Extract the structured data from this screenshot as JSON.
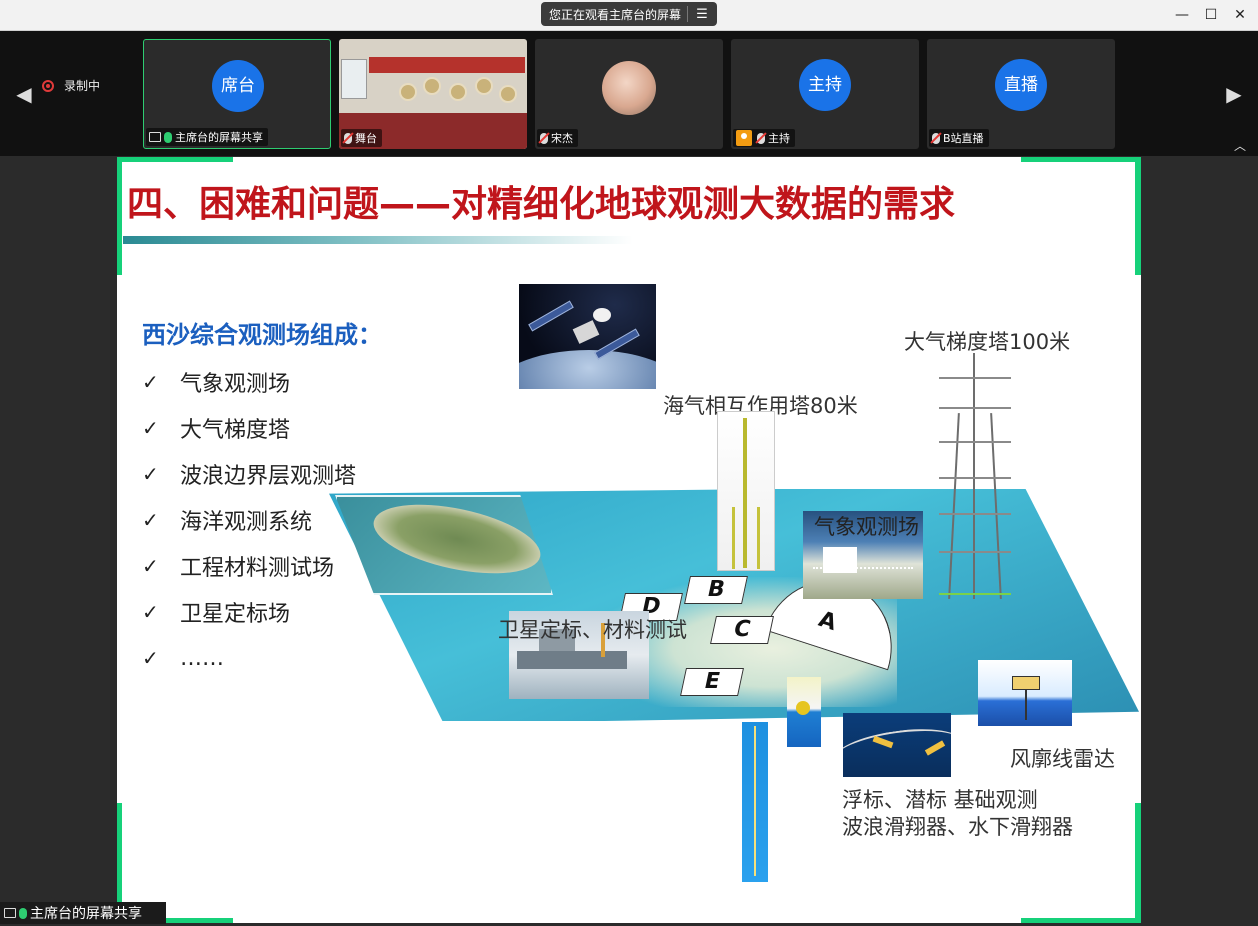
{
  "titlebar": {
    "viewing_text": "您正在观看主席台的屏幕"
  },
  "strip": {
    "recording_label": "录制中",
    "tiles": [
      {
        "avatar": "席台",
        "label": "主席台的屏幕共享"
      },
      {
        "label": "舞台"
      },
      {
        "label": "宋杰"
      },
      {
        "avatar": "主持",
        "label": "主持"
      },
      {
        "avatar": "直播",
        "label": "B站直播"
      }
    ]
  },
  "slide": {
    "title": "四、困难和问题——对精细化地球观测大数据的需求",
    "subhead": "西沙综合观测场组成：",
    "items": [
      "气象观测场",
      "大气梯度塔",
      "波浪边界层观测塔",
      "海洋观测系统",
      "工程材料测试场",
      "卫星定标场",
      "……"
    ],
    "labels": {
      "tower100": "大气梯度塔100米",
      "tower80": "海气相互作用塔80米",
      "met_field": "气象观测场",
      "calibration": "卫星定标、材料测试",
      "radar": "风廓线雷达",
      "buoy_line1": "浮标、潜标 基础观测",
      "buoy_line2": "波浪滑翔器、水下滑翔器"
    },
    "zones": [
      "A",
      "B",
      "C",
      "D",
      "E"
    ]
  },
  "share_tag": "主席台的屏幕共享",
  "colors": {
    "title_red": "#c0151b",
    "subhead_blue": "#1b5fbf",
    "frame_green": "#16d17a",
    "avatar_blue": "#1a73e8"
  }
}
